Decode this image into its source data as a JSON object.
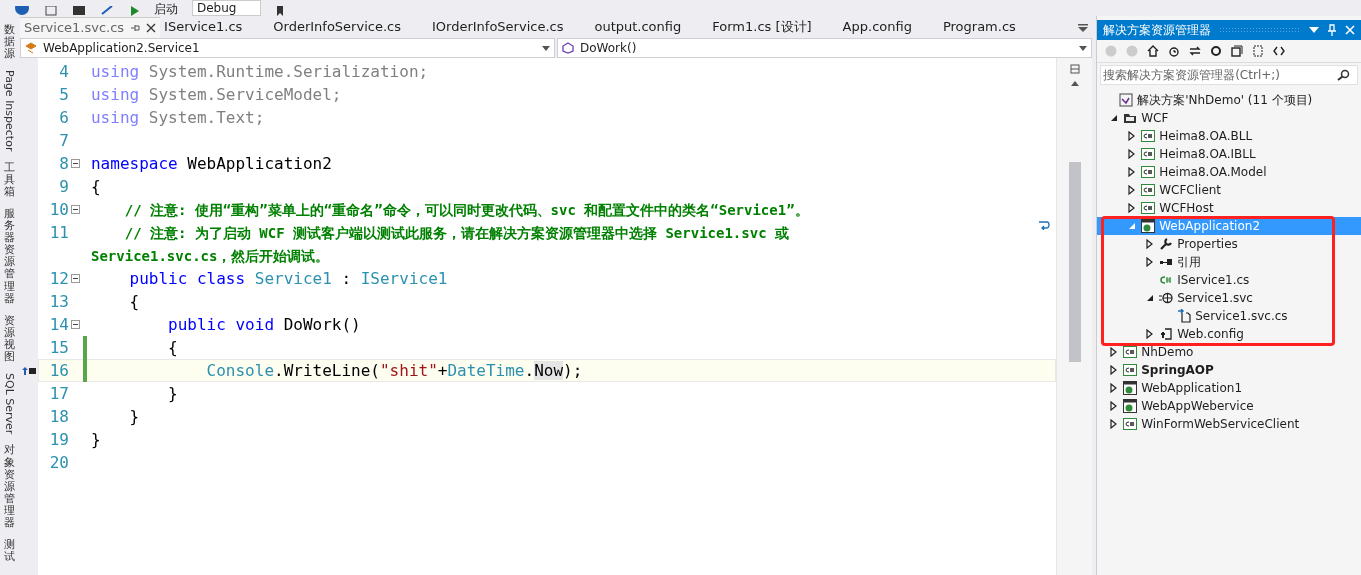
{
  "toolbar": {
    "run_label": "启动",
    "config": "Debug"
  },
  "left_strip": [
    {
      "label": "数据源",
      "kind": "stacked"
    },
    {
      "label": "Page Inspector",
      "kind": "rotated"
    },
    {
      "label": "工具箱",
      "kind": "stacked"
    },
    {
      "label": "服务器资源管理器",
      "kind": "stacked"
    },
    {
      "label": "资源视图",
      "kind": "stacked"
    },
    {
      "label": "SQL Server",
      "kind": "rotated"
    },
    {
      "label": "对象资源管理器",
      "kind": "stacked"
    },
    {
      "label": "测试",
      "kind": "stacked"
    }
  ],
  "tabs": [
    {
      "label": "Service1.svc.cs",
      "selected": true
    },
    {
      "label": "IService1.cs",
      "selected": false
    },
    {
      "label": "OrderInfoService.cs",
      "selected": false
    },
    {
      "label": "IOrderInfoService.cs",
      "selected": false
    },
    {
      "label": "output.config",
      "selected": false
    },
    {
      "label": "Form1.cs [设计]",
      "selected": false
    },
    {
      "label": "App.config",
      "selected": false
    },
    {
      "label": "Program.cs",
      "selected": false
    }
  ],
  "nav": {
    "type_combo": "WebApplication2.Service1",
    "member_combo": "DoWork()"
  },
  "code_lines": [
    {
      "number": "4",
      "fold": false,
      "changed": false,
      "current": false,
      "tokens": [
        {
          "kind": "faded_kw",
          "text": "using"
        },
        {
          "kind": "faded",
          "text": " System.Runtime.Serialization;"
        }
      ]
    },
    {
      "number": "5",
      "fold": false,
      "changed": false,
      "current": false,
      "tokens": [
        {
          "kind": "faded_kw",
          "text": "using"
        },
        {
          "kind": "faded",
          "text": " System.ServiceModel;"
        }
      ]
    },
    {
      "number": "6",
      "fold": false,
      "changed": false,
      "current": false,
      "tokens": [
        {
          "kind": "faded_kw",
          "text": "using"
        },
        {
          "kind": "faded",
          "text": " System.Text;"
        }
      ]
    },
    {
      "number": "7",
      "fold": false,
      "changed": false,
      "current": false
    },
    {
      "number": "8",
      "fold": true,
      "changed": false,
      "current": false,
      "tokens": [
        {
          "kind": "kw",
          "text": "namespace"
        },
        {
          "kind": "plain",
          "text": " WebApplication2"
        }
      ]
    },
    {
      "number": "9",
      "fold": false,
      "changed": false,
      "current": false,
      "tokens": [
        {
          "kind": "plain",
          "text": "{"
        }
      ]
    },
    {
      "number": "10",
      "fold": true,
      "changed": false,
      "current": false,
      "tokens": [
        {
          "kind": "comment",
          "text": "    // 注意: 使用“重构”菜单上的“重命名”命令，可以同时更改代码、svc 和配置文件中的类名“Service1”。"
        }
      ]
    },
    {
      "number": "11",
      "fold": false,
      "changed": false,
      "current": false,
      "tokens": [
        {
          "kind": "comment",
          "text": "    // 注意: 为了启动 WCF 测试客户端以测试此服务，请在解决方案资源管理器中选择 Service1.svc 或"
        }
      ],
      "wrapped": [
        {
          "kind": "comment",
          "text": "Service1.svc.cs，然后开始调试。"
        }
      ]
    },
    {
      "number": "12",
      "fold": true,
      "changed": false,
      "current": false,
      "tokens": [
        {
          "kind": "kw",
          "text": "    public class "
        },
        {
          "kind": "type",
          "text": "Service1"
        },
        {
          "kind": "plain",
          "text": " : "
        },
        {
          "kind": "type",
          "text": "IService1"
        }
      ]
    },
    {
      "number": "13",
      "fold": false,
      "changed": false,
      "current": false,
      "tokens": [
        {
          "kind": "plain",
          "text": "    {"
        }
      ]
    },
    {
      "number": "14",
      "fold": true,
      "changed": false,
      "current": false,
      "tokens": [
        {
          "kind": "kw",
          "text": "        public void"
        },
        {
          "kind": "plain",
          "text": " DoWork()"
        }
      ]
    },
    {
      "number": "15",
      "fold": false,
      "changed": true,
      "current": false,
      "tokens": [
        {
          "kind": "plain",
          "text": "        {"
        }
      ]
    },
    {
      "number": "16",
      "fold": false,
      "changed": true,
      "current": true,
      "tokens": [
        {
          "kind": "type",
          "text": "            Console"
        },
        {
          "kind": "plain",
          "text": ".WriteLine("
        },
        {
          "kind": "str",
          "text": "\"shit\""
        },
        {
          "kind": "plain",
          "text": "+"
        },
        {
          "kind": "type",
          "text": "DateTime"
        },
        {
          "kind": "plain",
          "text": "."
        },
        {
          "kind": "highlight",
          "text": "Now"
        },
        {
          "kind": "plain",
          "text": ");"
        }
      ]
    },
    {
      "number": "17",
      "fold": false,
      "changed": false,
      "current": false,
      "tokens": [
        {
          "kind": "plain",
          "text": "        }"
        }
      ]
    },
    {
      "number": "18",
      "fold": false,
      "changed": false,
      "current": false,
      "tokens": [
        {
          "kind": "plain",
          "text": "    }"
        }
      ]
    },
    {
      "number": "19",
      "fold": false,
      "changed": false,
      "current": false,
      "tokens": [
        {
          "kind": "plain",
          "text": "}"
        }
      ]
    },
    {
      "number": "20",
      "fold": false,
      "changed": false,
      "current": false
    }
  ],
  "solution_explorer": {
    "title": "解决方案资源管理器",
    "search": {
      "placeholder": "搜索解决方案资源管理器(Ctrl+;)"
    },
    "tree": [
      {
        "label": "解决方案'NhDemo' (11 个项目)",
        "kind": "solution",
        "expandable": false,
        "selected": false,
        "bold": false,
        "children": [
          {
            "label": "WCF",
            "kind": "folder",
            "expandable": true,
            "expanded": true,
            "selected": false,
            "bold": false,
            "children": [
              {
                "label": "Heima8.OA.BLL",
                "kind": "csproj",
                "expandable": true,
                "expanded": false,
                "selected": false,
                "bold": false
              },
              {
                "label": "Heima8.OA.IBLL",
                "kind": "csproj",
                "expandable": true,
                "expanded": false,
                "selected": false,
                "bold": false
              },
              {
                "label": "Heima8.OA.Model",
                "kind": "csproj",
                "expandable": true,
                "expanded": false,
                "selected": false,
                "bold": false
              },
              {
                "label": "WCFClient",
                "kind": "csproj",
                "expandable": true,
                "expanded": false,
                "selected": false,
                "bold": false
              },
              {
                "label": "WCFHost",
                "kind": "csproj",
                "expandable": true,
                "expanded": false,
                "selected": false,
                "bold": false
              },
              {
                "label": "WebApplication2",
                "kind": "webproj",
                "expandable": true,
                "expanded": true,
                "selected": true,
                "bold": false,
                "children": [
                  {
                    "label": "Properties",
                    "kind": "wrench",
                    "expandable": true,
                    "expanded": false,
                    "selected": false,
                    "bold": false
                  },
                  {
                    "label": "引用",
                    "kind": "refs",
                    "expandable": true,
                    "expanded": false,
                    "selected": false,
                    "bold": false
                  },
                  {
                    "label": "IService1.cs",
                    "kind": "csfile",
                    "expandable": false,
                    "expanded": false,
                    "selected": false,
                    "bold": false
                  },
                  {
                    "label": "Service1.svc",
                    "kind": "svc",
                    "expandable": true,
                    "expanded": true,
                    "selected": false,
                    "bold": false,
                    "children": [
                      {
                        "label": "Service1.svc.cs",
                        "kind": "svccs",
                        "expandable": false,
                        "expanded": false,
                        "selected": false,
                        "bold": false
                      }
                    ]
                  },
                  {
                    "label": "Web.config",
                    "kind": "config",
                    "expandable": true,
                    "expanded": false,
                    "selected": false,
                    "bold": false
                  }
                ]
              }
            ]
          },
          {
            "label": "NhDemo",
            "kind": "csproj",
            "expandable": true,
            "expanded": false,
            "selected": false,
            "bold": false
          },
          {
            "label": "SpringAOP",
            "kind": "csproj",
            "expandable": true,
            "expanded": false,
            "selected": false,
            "bold": true
          },
          {
            "label": "WebApplication1",
            "kind": "webproj",
            "expandable": true,
            "expanded": false,
            "selected": false,
            "bold": false
          },
          {
            "label": "WebAppWebervice",
            "kind": "webproj",
            "expandable": true,
            "expanded": false,
            "selected": false,
            "bold": false
          },
          {
            "label": "WinFormWebServiceClient",
            "kind": "csproj",
            "expandable": true,
            "expanded": false,
            "selected": false,
            "bold": false
          }
        ]
      }
    ]
  }
}
